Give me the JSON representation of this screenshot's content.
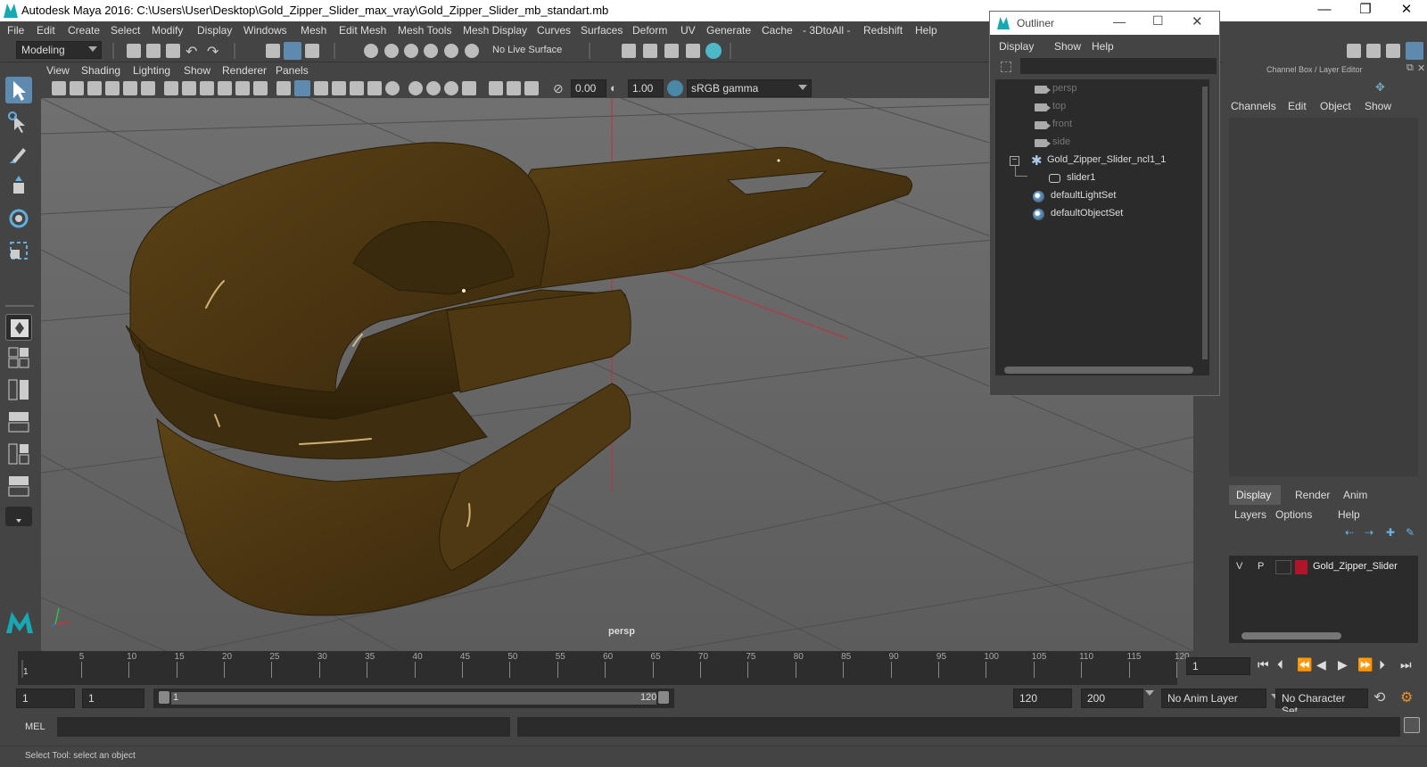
{
  "window": {
    "title": "Autodesk Maya 2016: C:\\Users\\User\\Desktop\\Gold_Zipper_Slider_max_vray\\Gold_Zipper_Slider_mb_standart.mb",
    "controls": [
      "—",
      "❐",
      "✕"
    ]
  },
  "menubar": [
    "File",
    "Edit",
    "Create",
    "Select",
    "Modify",
    "Display",
    "Windows",
    "Mesh",
    "Edit Mesh",
    "Mesh Tools",
    "Mesh Display",
    "Curves",
    "Surfaces",
    "Deform",
    "UV",
    "Generate",
    "Cache",
    "- 3DtoAll -",
    "Redshift",
    "Help"
  ],
  "statusline": {
    "mode": "Modeling",
    "live_surface": "No Live Surface"
  },
  "panel": {
    "menus": [
      "View",
      "Shading",
      "Lighting",
      "Show",
      "Renderer",
      "Panels"
    ],
    "exposure": "0.00",
    "gamma": "1.00",
    "color_space": "sRGB gamma",
    "camera_label": "persp"
  },
  "outliner": {
    "title": "Outliner",
    "menus": [
      "Display",
      "Show",
      "Help"
    ],
    "items": [
      {
        "label": "persp",
        "type": "camera",
        "dim": true
      },
      {
        "label": "top",
        "type": "camera",
        "dim": true
      },
      {
        "label": "front",
        "type": "camera",
        "dim": true
      },
      {
        "label": "side",
        "type": "camera",
        "dim": true
      },
      {
        "label": "Gold_Zipper_Slider_ncl1_1",
        "type": "group",
        "dim": false
      },
      {
        "label": "slider1",
        "type": "mesh",
        "dim": false
      },
      {
        "label": "defaultLightSet",
        "type": "set",
        "dim": false
      },
      {
        "label": "defaultObjectSet",
        "type": "set",
        "dim": false
      }
    ]
  },
  "channelbox": {
    "title": "Channel Box / Layer Editor",
    "menus": [
      "Channels",
      "Edit",
      "Object",
      "Show"
    ],
    "tabs": [
      "Display",
      "Render",
      "Anim"
    ],
    "layer_menus": [
      "Layers",
      "Options",
      "Help"
    ],
    "layer": {
      "v": "V",
      "p": "P",
      "name": "Gold_Zipper_Slider",
      "color": "#b0152a"
    }
  },
  "timeline": {
    "ticks": [
      "5",
      "10",
      "15",
      "20",
      "25",
      "30",
      "35",
      "40",
      "45",
      "50",
      "55",
      "60",
      "65",
      "70",
      "75",
      "80",
      "85",
      "90",
      "95",
      "100",
      "105",
      "110",
      "115",
      "120"
    ],
    "current_marker": "1",
    "current_frame": "1"
  },
  "range": {
    "start": "1",
    "start2": "1",
    "slider_start": "1",
    "slider_end": "120",
    "end": "120",
    "end2": "200",
    "anim_layer": "No Anim Layer",
    "character_set": "No Character Set"
  },
  "cmdline": {
    "label": "MEL"
  },
  "helpline": {
    "text": "Select Tool: select an object"
  },
  "colors": {
    "accent": "#5f8ab0",
    "zipper": "#4a3511",
    "layer": "#b0152a"
  }
}
